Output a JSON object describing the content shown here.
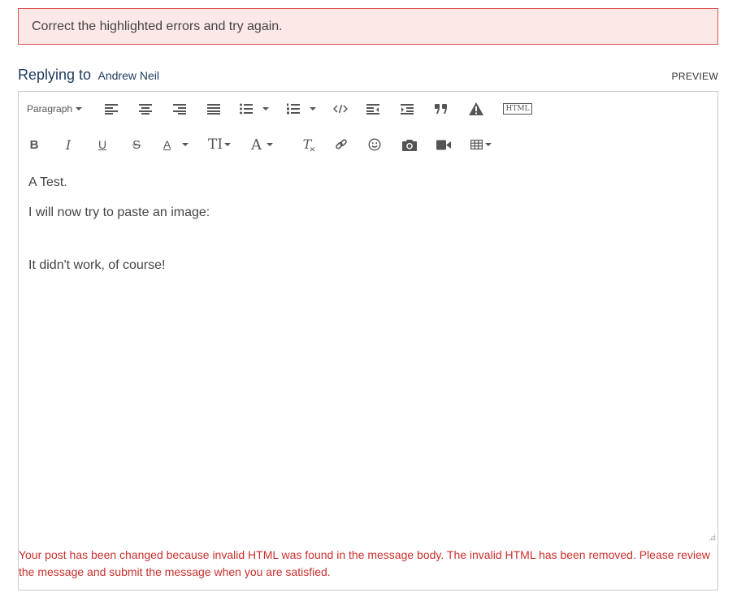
{
  "alert": {
    "text": "Correct the highlighted errors and try again."
  },
  "reply": {
    "prefix": "Replying to",
    "author": "Andrew Neil",
    "preview_label": "PREVIEW"
  },
  "toolbar": {
    "paragraph_label": "Paragraph",
    "html_label": "HTML",
    "row1": [
      "paragraph-format",
      "align-left",
      "align-center",
      "align-right",
      "align-justify",
      "bulleted-list",
      "numbered-list",
      "code",
      "outdent",
      "indent",
      "quote",
      "spoiler-warning",
      "html-source"
    ],
    "row2": [
      "bold",
      "italic",
      "underline",
      "strikethrough",
      "font-color",
      "font-size",
      "font-family",
      "clear-formatting",
      "insert-link",
      "emoji",
      "insert-image",
      "insert-video",
      "insert-table"
    ],
    "glyphs": {
      "bold": "B",
      "italic": "I",
      "underline": "U",
      "strike": "S",
      "font_color": "A",
      "font_size": "TI",
      "font_family": "A",
      "clear": "T"
    }
  },
  "editor": {
    "lines": [
      "A Test.",
      "I will now try to paste an image:",
      "It didn't work, of course!"
    ]
  },
  "error": {
    "message": "Your post has been changed because invalid HTML was found in the message body. The invalid HTML has been removed. Please review the message and submit the message when you are satisfied."
  }
}
